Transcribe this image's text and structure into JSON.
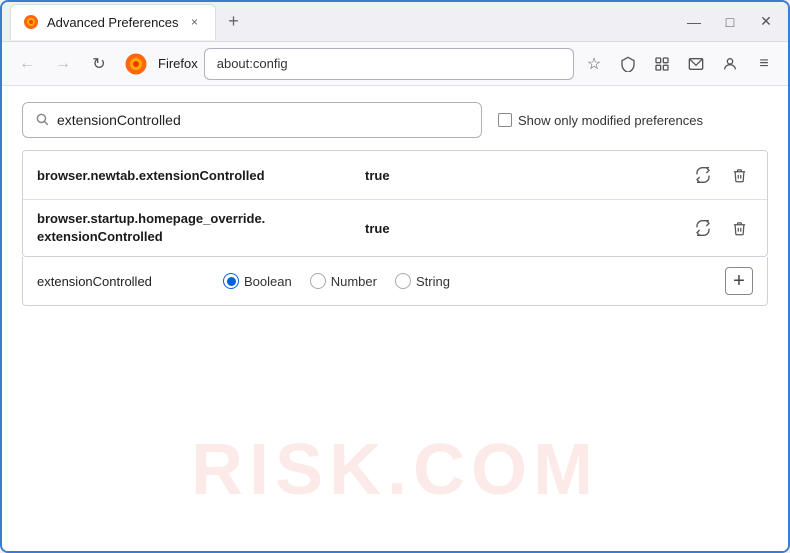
{
  "window": {
    "title": "Advanced Preferences",
    "tab_close": "×",
    "new_tab": "+",
    "minimize": "—",
    "maximize": "□",
    "close": "✕"
  },
  "navbar": {
    "back": "←",
    "forward": "→",
    "reload": "↻",
    "firefox_label": "Firefox",
    "address": "about:config",
    "bookmark_icon": "☆",
    "shield_icon": "🛡",
    "extension_icon": "🧩",
    "mail_icon": "✉",
    "account_icon": "◑",
    "menu_icon": "≡"
  },
  "search": {
    "value": "extensionControlled",
    "placeholder": "Search preference name",
    "show_modified_label": "Show only modified preferences"
  },
  "preferences": {
    "rows": [
      {
        "name": "browser.newtab.extensionControlled",
        "value": "true"
      },
      {
        "name_line1": "browser.startup.homepage_override.",
        "name_line2": "extensionControlled",
        "value": "true"
      }
    ]
  },
  "new_pref": {
    "name": "extensionControlled",
    "types": [
      {
        "label": "Boolean",
        "selected": true
      },
      {
        "label": "Number",
        "selected": false
      },
      {
        "label": "String",
        "selected": false
      }
    ],
    "add_label": "+"
  },
  "watermark": "RISK.COM"
}
